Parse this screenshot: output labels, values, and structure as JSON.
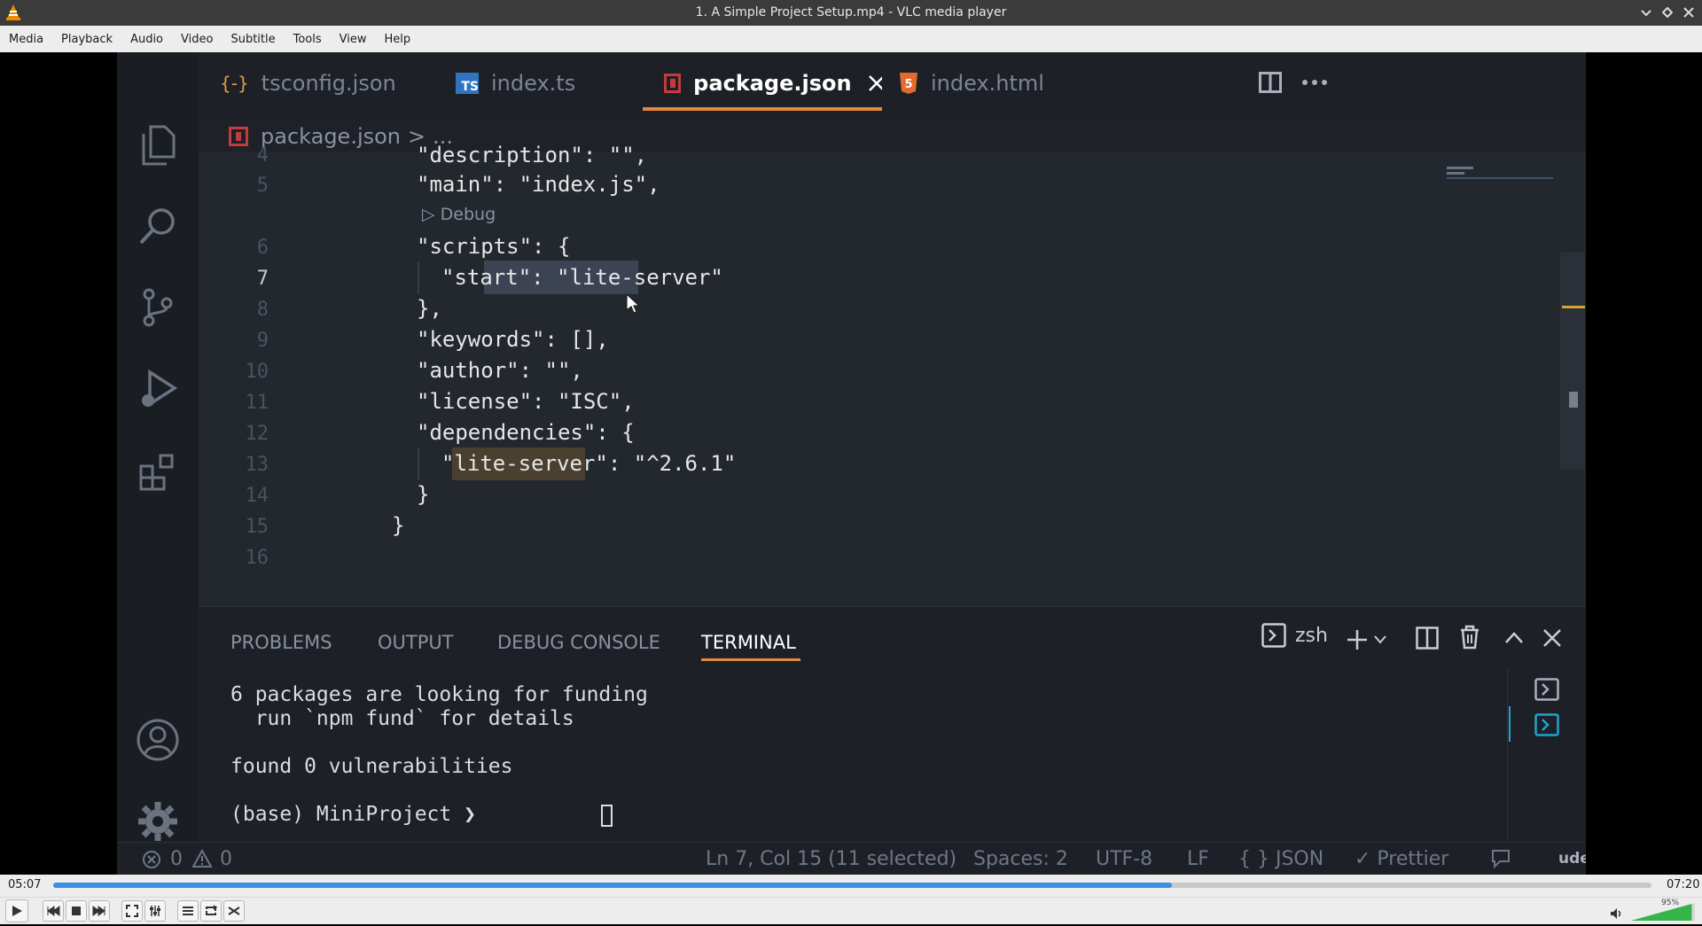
{
  "window": {
    "title": "1. A Simple Project Setup.mp4 - VLC media player"
  },
  "menu": [
    "Media",
    "Playback",
    "Audio",
    "Video",
    "Subtitle",
    "Tools",
    "View",
    "Help"
  ],
  "vscode": {
    "tabs": [
      {
        "icon": "{-}",
        "label": "tsconfig.json"
      },
      {
        "icon": "TS",
        "label": "index.ts"
      },
      {
        "icon": "npm",
        "label": "package.json",
        "active": true
      },
      {
        "icon": "5",
        "label": "index.html"
      }
    ],
    "breadcrumb": {
      "file": "package.json",
      "sep": ">",
      "rest": "..."
    },
    "editor_lines": [
      {
        "num": "4",
        "text": "\"description\": \"\","
      },
      {
        "num": "5",
        "text": "\"main\": \"index.js\","
      },
      {
        "num": "",
        "text": "▷ Debug"
      },
      {
        "num": "6",
        "text": "\"scripts\": {"
      },
      {
        "num": "7",
        "text": "\"start\": \"lite-server\""
      },
      {
        "num": "8",
        "text": "},"
      },
      {
        "num": "9",
        "text": "\"keywords\": [],"
      },
      {
        "num": "10",
        "text": "\"author\": \"\","
      },
      {
        "num": "11",
        "text": "\"license\": \"ISC\","
      },
      {
        "num": "12",
        "text": "\"dependencies\": {"
      },
      {
        "num": "13",
        "text": "\"lite-server\": \"^2.6.1\""
      },
      {
        "num": "14",
        "text": "}"
      },
      {
        "num": "15",
        "text": "}"
      },
      {
        "num": "16",
        "text": ""
      }
    ],
    "panel_tabs": [
      "PROBLEMS",
      "OUTPUT",
      "DEBUG CONSOLE",
      "TERMINAL"
    ],
    "terminal_shell": "zsh",
    "terminal_lines": [
      "6 packages are looking for funding",
      "  run `npm fund` for details",
      "",
      "found 0 vulnerabilities",
      "",
      "(base) MiniProject ❯ "
    ],
    "status": {
      "errors": "0",
      "warnings": "0",
      "position": "Ln 7, Col 15 (11 selected)",
      "spaces": "Spaces: 2",
      "encoding": "UTF-8",
      "eol": "LF",
      "language": "{ } JSON",
      "formatter": "✓ Prettier",
      "watermark": "udemy"
    }
  },
  "player": {
    "elapsed": "05:07",
    "total": "07:20",
    "progress": 0.7
  },
  "volume": {
    "label": "95%",
    "level": 0.95
  }
}
